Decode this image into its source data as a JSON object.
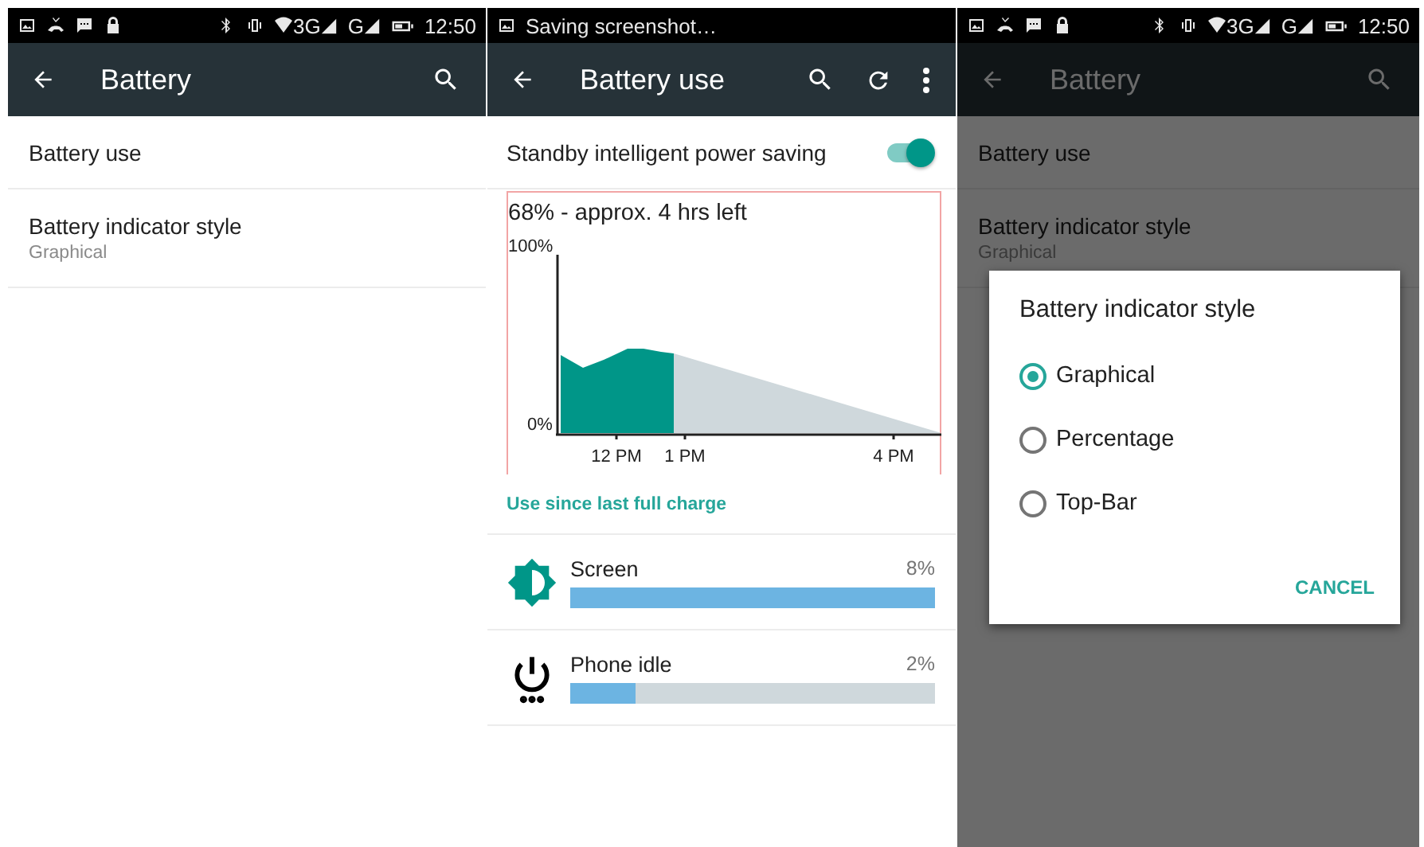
{
  "screens": [
    {
      "kind": "settings",
      "dimmed": false,
      "status_bar": {
        "network_1": "3G",
        "network_2": "G",
        "time": "12:50"
      },
      "app_bar": {
        "title": "Battery"
      },
      "items": [
        {
          "title": "Battery use"
        },
        {
          "title": "Battery indicator style",
          "summary": "Graphical"
        }
      ]
    },
    {
      "kind": "battery_use",
      "dimmed": false,
      "status_bar": {
        "notification": "Saving screenshot…"
      },
      "app_bar": {
        "title": "Battery use"
      },
      "toggle": {
        "label": "Standby intelligent power saving",
        "on": true
      },
      "chart": {
        "title": "68% - approx. 4 hrs left",
        "y_labels": [
          "100%",
          "0%"
        ],
        "x_labels": [
          "12 PM",
          "1 PM",
          "4 PM"
        ]
      },
      "section_header": "Use since last full charge",
      "usage": [
        {
          "kind": "brightness",
          "name": "Screen",
          "percent": "8%",
          "level": 1.0
        },
        {
          "kind": "power",
          "name": "Phone idle",
          "percent": "2%",
          "level": 0.18
        }
      ]
    },
    {
      "kind": "settings",
      "dimmed": true,
      "status_bar": {
        "network_1": "3G",
        "network_2": "G",
        "time": "12:50"
      },
      "app_bar": {
        "title": "Battery"
      },
      "items": [
        {
          "title": "Battery use"
        },
        {
          "title": "Battery indicator style",
          "summary": "Graphical"
        }
      ],
      "dialog": {
        "title": "Battery indicator style",
        "options": [
          {
            "label": "Graphical",
            "selected": true
          },
          {
            "label": "Percentage",
            "selected": false
          },
          {
            "label": "Top-Bar",
            "selected": false
          }
        ],
        "button": "CANCEL"
      }
    }
  ]
}
